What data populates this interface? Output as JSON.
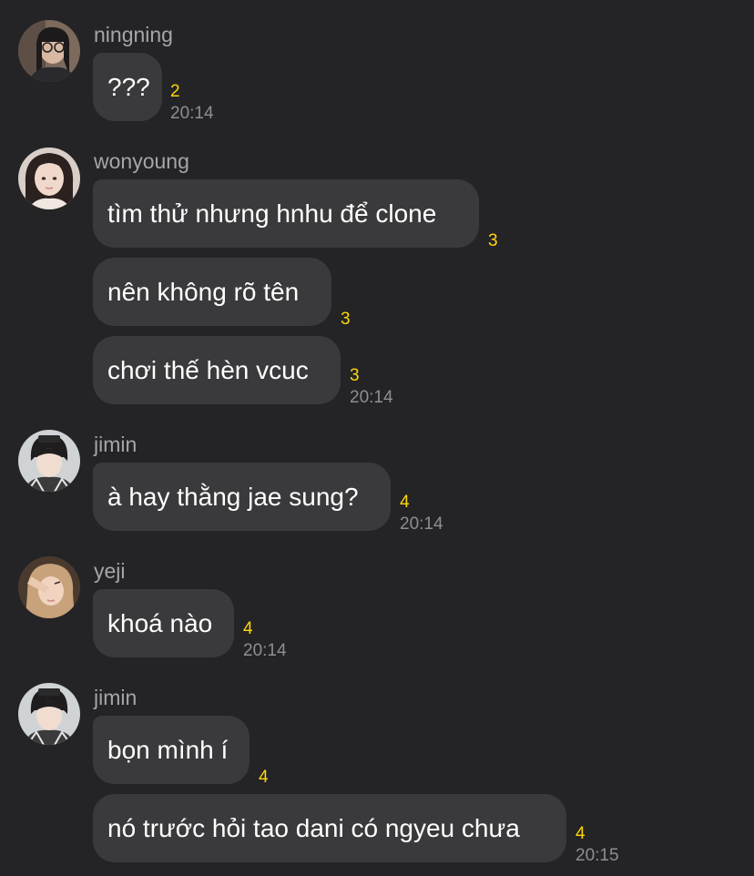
{
  "colors": {
    "background": "#242426",
    "bubble": "#3a3a3c",
    "name": "#a5a5aa",
    "unread": "#ffd60a",
    "timestamp": "#8e8e93"
  },
  "groups": [
    {
      "sender": "ningning",
      "avatar": "avatar-ningning",
      "messages": [
        {
          "text": "???",
          "unread": "2"
        }
      ],
      "time": "20:14"
    },
    {
      "sender": "wonyoung",
      "avatar": "avatar-wonyoung",
      "messages": [
        {
          "text": "tìm thử nhưng hnhu để clone",
          "unread": "3"
        },
        {
          "text": "nên không rõ tên",
          "unread": "3"
        },
        {
          "text": "chơi thế hèn vcuc",
          "unread": "3"
        }
      ],
      "time": "20:14"
    },
    {
      "sender": "jimin",
      "avatar": "avatar-jimin",
      "messages": [
        {
          "text": "à hay thằng jae sung?",
          "unread": "4"
        }
      ],
      "time": "20:14"
    },
    {
      "sender": "yeji",
      "avatar": "avatar-yeji",
      "messages": [
        {
          "text": "khoá nào",
          "unread": "4"
        }
      ],
      "time": "20:14"
    },
    {
      "sender": "jimin",
      "avatar": "avatar-jimin",
      "messages": [
        {
          "text": "bọn mình í",
          "unread": "4"
        },
        {
          "text": "nó trước hỏi tao dani có ngyeu chưa",
          "unread": "4"
        }
      ],
      "time": "20:15"
    }
  ]
}
